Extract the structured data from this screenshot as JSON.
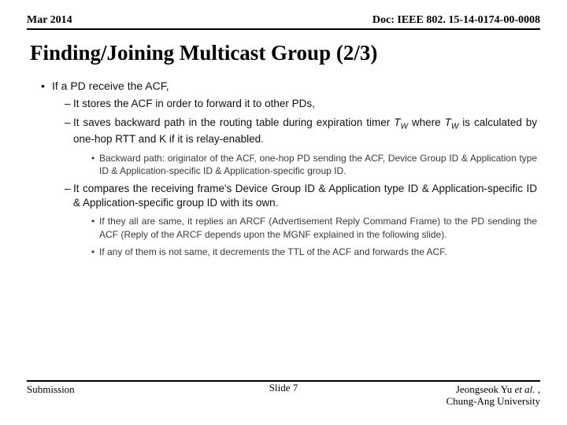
{
  "header": {
    "date": "Mar 2014",
    "doc": "Doc: IEEE 802. 15-14-0174-00-0008"
  },
  "title": "Finding/Joining Multicast Group (2/3)",
  "body": {
    "l1_1": "If a PD receive the ACF,",
    "l2_1": "It stores the ACF in order to forward it to other PDs,",
    "l2_2a": "It saves backward path in the routing table during expiration timer ",
    "l2_2_tw1": "T",
    "l2_2_tw1s": "W",
    "l2_2b": " where ",
    "l2_2_tw2": "T",
    "l2_2_tw2s": "W",
    "l2_2c": " is calculated by one-hop RTT and K if it is relay-enabled.",
    "l3_1": "Backward path: originator of the ACF, one-hop PD sending the ACF, Device Group ID & Application type ID & Application-specific ID & Application-specific group ID.",
    "l2_3": "It compares the receiving frame's Device Group ID & Application type ID & Application-specific ID & Application-specific group ID with its own.",
    "l3_2": "If they all are same, it replies an ARCF (Advertisement Reply Command Frame) to the PD sending the ACF (Reply of the ARCF depends upon the MGNF explained in the  following slide).",
    "l3_3": "If any of them is not same, it decrements the TTL of the ACF and forwards the ACF."
  },
  "footer": {
    "left": "Submission",
    "center": "Slide 7",
    "right1a": "Jeongseok Yu ",
    "right1b": "et al.",
    "right1c": " ,",
    "right2": "Chung-Ang University"
  }
}
